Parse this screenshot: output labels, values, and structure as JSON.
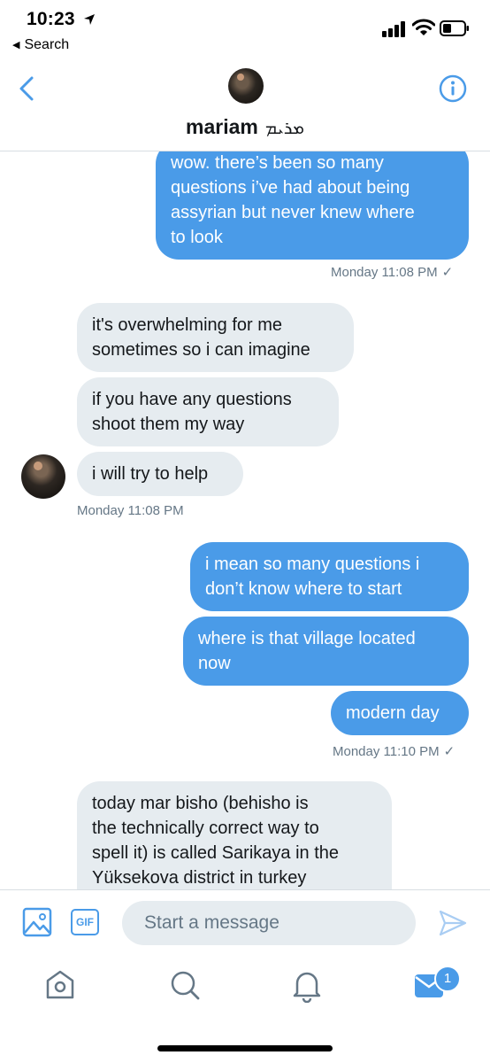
{
  "status_bar": {
    "time": "10:23",
    "back_label": "Search",
    "icons": [
      "location-arrow-icon",
      "cellular-signal-icon",
      "wifi-icon",
      "battery-icon"
    ]
  },
  "header": {
    "name": "mariam",
    "name_script": "ܡܪܝܡ",
    "icons": [
      "back-chevron-icon",
      "info-icon"
    ]
  },
  "conversation": {
    "messages": [
      {
        "direction": "sent",
        "lines": [
          "wow. there’s been so many",
          "questions i’ve had about being",
          "assyrian but never knew where",
          "to look"
        ]
      },
      {
        "direction": "received",
        "lines": [
          "it's overwhelming for me",
          "sometimes so i can imagine"
        ]
      },
      {
        "direction": "received",
        "lines": [
          "if you have any questions",
          "shoot them my way"
        ]
      },
      {
        "direction": "received",
        "lines": [
          "i will try to help"
        ]
      },
      {
        "direction": "sent",
        "lines": [
          "i mean so many questions i",
          "don’t know where to start"
        ]
      },
      {
        "direction": "sent",
        "lines": [
          "where is that village located",
          "now"
        ]
      },
      {
        "direction": "sent",
        "lines": [
          "modern day"
        ]
      },
      {
        "direction": "received",
        "lines": [
          "today mar bisho (behisho is",
          "the technically correct way to",
          "spell it) is called Sarikaya in the",
          "Yüksekova district in turkey"
        ]
      }
    ],
    "timestamps": {
      "t1": "Monday 11:08 PM",
      "t2": "Monday 11:08 PM",
      "t3": "Monday 11:10 PM"
    },
    "read_mark": "✓"
  },
  "composer": {
    "placeholder": "Start a message",
    "gif_label": "GIF",
    "icons": [
      "photo-icon",
      "gif-icon",
      "send-icon"
    ]
  },
  "tab_bar": {
    "tabs": [
      "home-icon",
      "search-icon",
      "notifications-icon",
      "messages-icon"
    ],
    "messages_badge": "1"
  },
  "colors": {
    "accent": "#4a9be8",
    "received_bubble": "#e6ecf0",
    "meta_text": "#657786"
  }
}
